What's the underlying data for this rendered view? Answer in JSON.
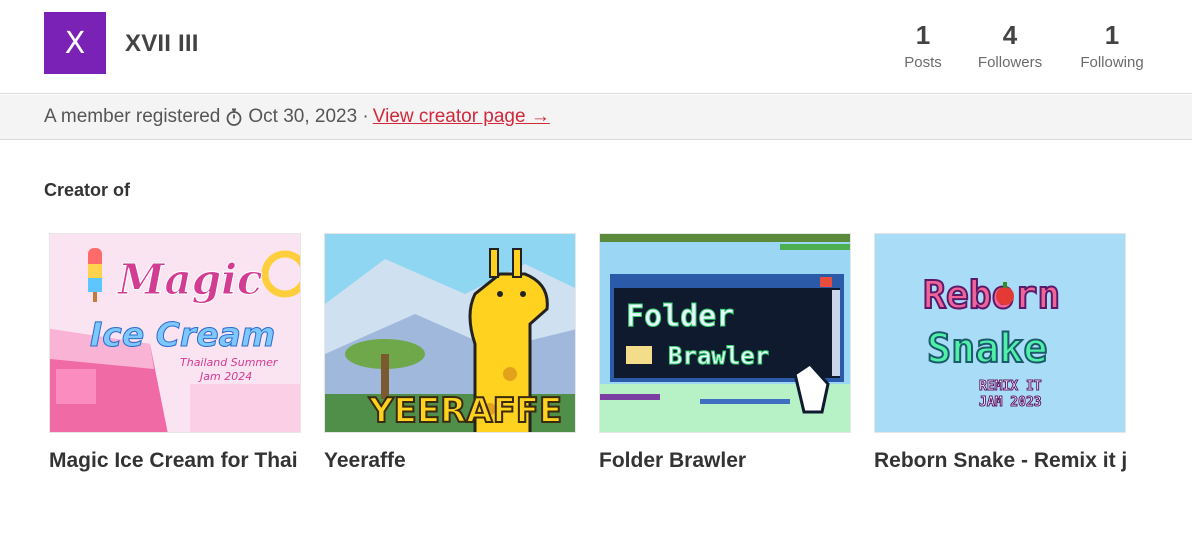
{
  "user": {
    "avatar_letter": "X",
    "name": "XVII III",
    "avatar_color": "#7b22b6"
  },
  "stats": [
    {
      "value": "1",
      "label": "Posts"
    },
    {
      "value": "4",
      "label": "Followers"
    },
    {
      "value": "1",
      "label": "Following"
    }
  ],
  "info": {
    "registered_text": "A member registered",
    "date_text": "Oct 30, 2023 ·",
    "creator_link": "View creator page →"
  },
  "section": {
    "title": "Creator of"
  },
  "games": [
    {
      "title": "Magic Ice Cream for Thai",
      "thumb_text": [
        "Magic",
        "Ice Cream",
        "Thailand Summer",
        "Jam 2024"
      ]
    },
    {
      "title": "Yeeraffe",
      "thumb_text": [
        "YEERAFFE"
      ]
    },
    {
      "title": "Folder Brawler",
      "thumb_text": [
        "Folder",
        "Brawler"
      ]
    },
    {
      "title": "Reborn Snake - Remix it j",
      "thumb_text": [
        "Reborn",
        "Snake",
        "REMIX IT",
        "JAM 2023"
      ]
    }
  ],
  "colors": {
    "accent_link": "#d1283c",
    "avatar": "#7b22b6",
    "infobar_bg": "#f4f4f4"
  }
}
